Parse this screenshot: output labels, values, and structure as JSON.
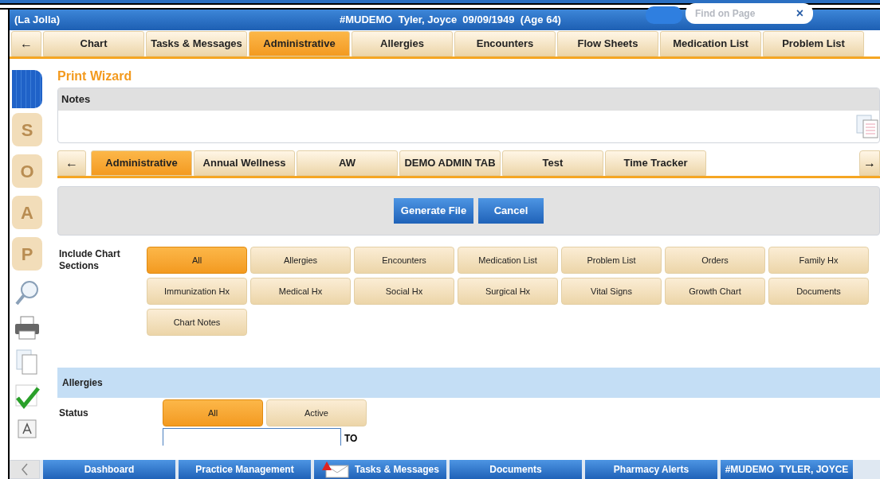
{
  "header": {
    "location": "(La Jolla)",
    "patient": "#MUDEMO  Tyler, Joyce  09/09/1949  (Age 64)",
    "search": {
      "placeholder": "Find on Page"
    },
    "clear": "×"
  },
  "main_tabs": [
    {
      "label": "←",
      "kind": "arrow",
      "selected": false
    },
    {
      "label": "Chart",
      "kind": "tab",
      "selected": false
    },
    {
      "label": "Tasks & Messages",
      "kind": "tab",
      "selected": false
    },
    {
      "label": "Administrative",
      "kind": "tab",
      "selected": true
    },
    {
      "label": "Allergies",
      "kind": "tab",
      "selected": false
    },
    {
      "label": "Encounters",
      "kind": "tab",
      "selected": false
    },
    {
      "label": "Flow Sheets",
      "kind": "tab",
      "selected": false
    },
    {
      "label": "Medication List",
      "kind": "tab",
      "selected": false
    },
    {
      "label": "Problem List",
      "kind": "tab",
      "selected": false
    }
  ],
  "sidebar": [
    {
      "label": "S"
    },
    {
      "label": "O"
    },
    {
      "label": "A"
    },
    {
      "label": "P"
    }
  ],
  "title": "Print Wizard",
  "notes": {
    "label": "Notes"
  },
  "sub_tabs": [
    {
      "label": "←",
      "kind": "arrow",
      "selected": false
    },
    {
      "label": "Administrative",
      "kind": "tab",
      "selected": true
    },
    {
      "label": "Annual Wellness",
      "kind": "tab",
      "selected": false
    },
    {
      "label": "AW",
      "kind": "tab",
      "selected": false
    },
    {
      "label": "DEMO ADMIN TAB",
      "kind": "tab",
      "selected": false
    },
    {
      "label": "Test",
      "kind": "tab",
      "selected": false
    },
    {
      "label": "Time Tracker",
      "kind": "tab",
      "selected": false
    }
  ],
  "next_arrow": "→",
  "actions": [
    "Generate File",
    "Cancel"
  ],
  "include_label": "Include Chart Sections",
  "sections": [
    {
      "label": "All",
      "selected": true
    },
    {
      "label": "Allergies",
      "selected": false
    },
    {
      "label": "Encounters",
      "selected": false
    },
    {
      "label": "Medication List",
      "selected": false
    },
    {
      "label": "Problem List",
      "selected": false
    },
    {
      "label": "Orders",
      "selected": false
    },
    {
      "label": "Family Hx",
      "selected": false
    },
    {
      "label": "Immunization Hx",
      "selected": false
    },
    {
      "label": "Medical Hx",
      "selected": false
    },
    {
      "label": "Social Hx",
      "selected": false
    },
    {
      "label": "Surgical Hx",
      "selected": false
    },
    {
      "label": "Vital Signs",
      "selected": false
    },
    {
      "label": "Growth Chart",
      "selected": false
    },
    {
      "label": "Documents",
      "selected": false
    },
    {
      "label": "Chart Notes",
      "selected": false
    }
  ],
  "allergies": {
    "heading": "Allergies",
    "status_label": "Status",
    "status": [
      {
        "label": "All",
        "selected": true
      },
      {
        "label": "Active",
        "selected": false
      }
    ],
    "to_label": "TO"
  },
  "taskbar": [
    {
      "label": "Dashboard",
      "alert": false
    },
    {
      "label": "Practice Management",
      "alert": false
    },
    {
      "label": "Tasks & Messages",
      "alert": true
    },
    {
      "label": "Documents",
      "alert": false
    },
    {
      "label": "Pharmacy Alerts",
      "alert": false
    },
    {
      "label": "#MUDEMO  TYLER, JOYCE",
      "alert": false
    }
  ]
}
